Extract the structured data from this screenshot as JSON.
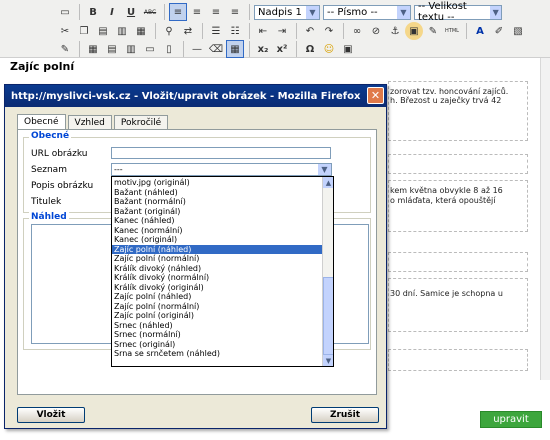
{
  "editor": {
    "title": "Zajíc polní",
    "save_button": "upravit",
    "toolbar": {
      "format_select": "Nadpis 1",
      "font_select": "-- Písmo --",
      "size_select": "-- Velikost textu --",
      "icons_row1": [
        "new-doc-icon",
        "bold-icon",
        "italic-icon",
        "underline-icon",
        "strike-icon",
        "align-left-icon",
        "align-center-icon",
        "align-right-icon",
        "align-justify-icon"
      ],
      "icons_row2": [
        "cut-icon",
        "copy-icon",
        "paste-icon",
        "paste-text-icon",
        "paste-word-icon",
        "find-icon",
        "replace-icon",
        "bullet-list-icon",
        "number-list-icon",
        "outdent-icon",
        "indent-icon",
        "undo-icon",
        "redo-icon",
        "link-icon",
        "unlink-icon",
        "anchor-icon",
        "image-icon",
        "cleanup-icon",
        "html-icon",
        "font-color-icon",
        "bg-color-icon",
        "preview-icon"
      ],
      "icons_row3": [
        "edit-icon",
        "table-icon",
        "row-icon",
        "col-icon",
        "merge-icon",
        "split-icon",
        "hr-icon",
        "eraser-icon",
        "visual-aid-icon",
        "subscript-icon",
        "superscript-icon",
        "charmap-icon",
        "emoticon-icon",
        "media-icon"
      ],
      "labels": {
        "bold": "B",
        "italic": "I",
        "underline": "U",
        "strike": "ABC",
        "html": "HTML",
        "subscript": "x₂",
        "superscript": "x²",
        "omega": "Ω",
        "font_color": "A"
      }
    },
    "side_text": [
      "zorovat tzv. honcování zajíců.",
      "h. Březost u zaječky trvá 42",
      "kem května obvykle 8 až 16",
      "o mláďata, která opouštějí",
      "30 dní. Samice je schopna u"
    ]
  },
  "dialog": {
    "title": "http://myslivci-vsk.cz - Vložit/upravit obrázek - Mozilla Firefox",
    "close_glyph": "✕",
    "tabs": [
      "Obecné",
      "Vzhled",
      "Pokročilé"
    ],
    "legend_general": "Obecné",
    "labels": {
      "url": "URL obrázku",
      "list": "Seznam",
      "desc": "Popis obrázku",
      "title": "Titulek"
    },
    "select_value": "---",
    "preview_legend": "Náhled",
    "insert_button": "Vložit",
    "cancel_button": "Zrušit",
    "dropdown": {
      "items": [
        "motiv.jpg (originál)",
        "Bažant (náhled)",
        "Bažant (normální)",
        "Bažant (originál)",
        "Kanec (náhled)",
        "Kanec (normální)",
        "Kanec (originál)",
        "Zajíc polní (náhled)",
        "Zajíc polní (normální)",
        "Králík divoký (náhled)",
        "Králík divoký (normální)",
        "Králík divoký (originál)",
        "Zajíc polní (náhled)",
        "Zajíc polní (normální)",
        "Zajíc polní (originál)",
        "Srnec (náhled)",
        "Srnec (normální)",
        "Srnec (originál)",
        "Srna se srnčetem (náhled)"
      ],
      "selected_index": 7
    }
  },
  "colors": {
    "accent": "#316ac5",
    "title_bar": "#0a3a8f",
    "save_button": "#3da63d"
  }
}
